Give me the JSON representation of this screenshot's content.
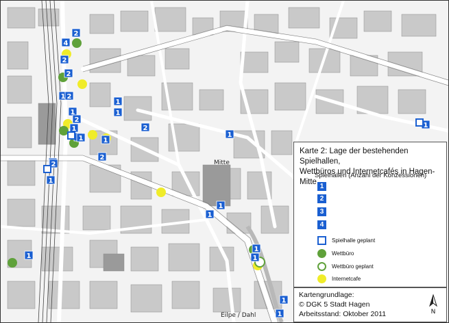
{
  "legend": {
    "title_line1": "Karte 2: Lage der bestehenden Spielhallen,",
    "title_line2": "Wettbüros und Internetcafés in Hagen-Mitte",
    "subtitle": "Spielhallen (Anzahl der Konzessionen)",
    "items": [
      {
        "symbol": "1",
        "label": ""
      },
      {
        "symbol": "2",
        "label": ""
      },
      {
        "symbol": "3",
        "label": ""
      },
      {
        "symbol": "4",
        "label": ""
      },
      {
        "symbol": "",
        "label": "Spielhalle geplant"
      },
      {
        "symbol": "",
        "label": "Wettbüro"
      },
      {
        "symbol": "",
        "label": "Wettbüro geplant"
      },
      {
        "symbol": "",
        "label": "Internetcafe"
      }
    ]
  },
  "credits": {
    "line1": "Kartengrundlage:",
    "line2": "© DGK 5 Stadt Hagen",
    "line3": "Arbeitsstand: Oktober 2011",
    "north_label": "N"
  },
  "place_labels": {
    "mitte": "Mitte",
    "street": "Eilpe / Dahl"
  },
  "markers": {
    "spielhallen_counts": [
      "2",
      "4",
      "2",
      "2",
      "1",
      "2",
      "1",
      "2",
      "1",
      "1",
      "1",
      "1",
      "2",
      "1",
      "2",
      "1",
      "1",
      "1",
      "1",
      "1",
      "1",
      "1",
      "2",
      "1",
      "1",
      "1",
      "1",
      "1"
    ],
    "colors": {
      "spielhalle": "#1a5fd1",
      "wettbuero": "#5fa13a",
      "internetcafe": "#f0ec2a"
    }
  }
}
